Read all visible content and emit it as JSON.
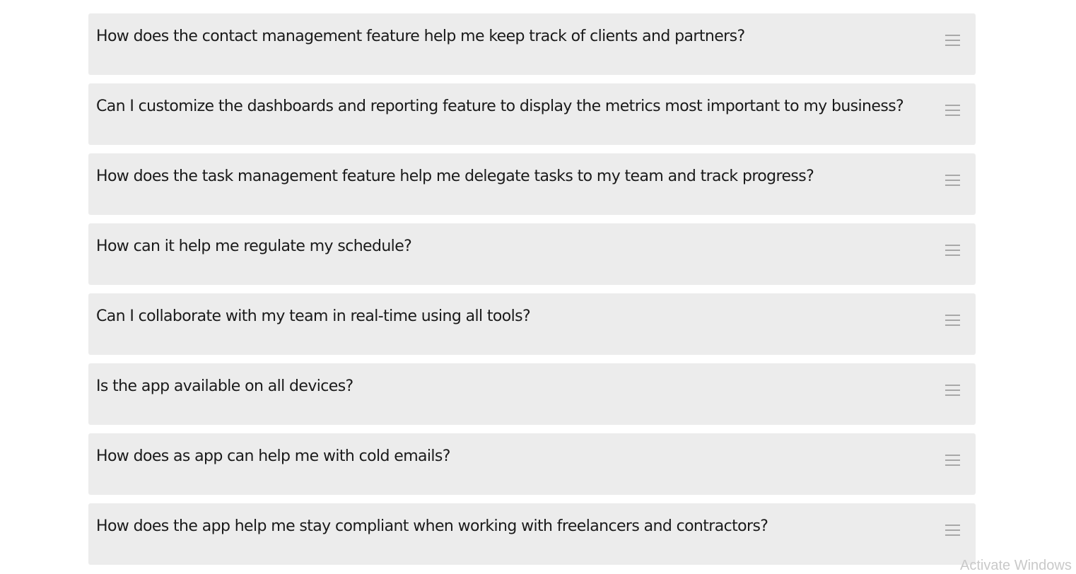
{
  "faq": {
    "items": [
      {
        "question": "How does the contact management feature help me keep track of clients and partners?",
        "icon": "menu-icon"
      },
      {
        "question": "Can I customize the dashboards and reporting feature to display the metrics most important to my business?",
        "icon": "menu-icon"
      },
      {
        "question": "How does the task management feature help me delegate tasks to my team and track progress?",
        "icon": "menu-icon"
      },
      {
        "question": "How can it help me regulate my schedule?",
        "icon": "menu-icon"
      },
      {
        "question": "Can I collaborate with my team in real-time using all tools?",
        "icon": "menu-icon"
      },
      {
        "question": "Is the app available on all devices?",
        "icon": "menu-icon"
      },
      {
        "question": "How does as app can help me with cold emails?",
        "icon": "menu-icon"
      },
      {
        "question": "How does the app help me stay compliant when working with freelancers and contractors?",
        "icon": "menu-icon"
      }
    ]
  },
  "watermark": {
    "text": "Activate Windows"
  }
}
